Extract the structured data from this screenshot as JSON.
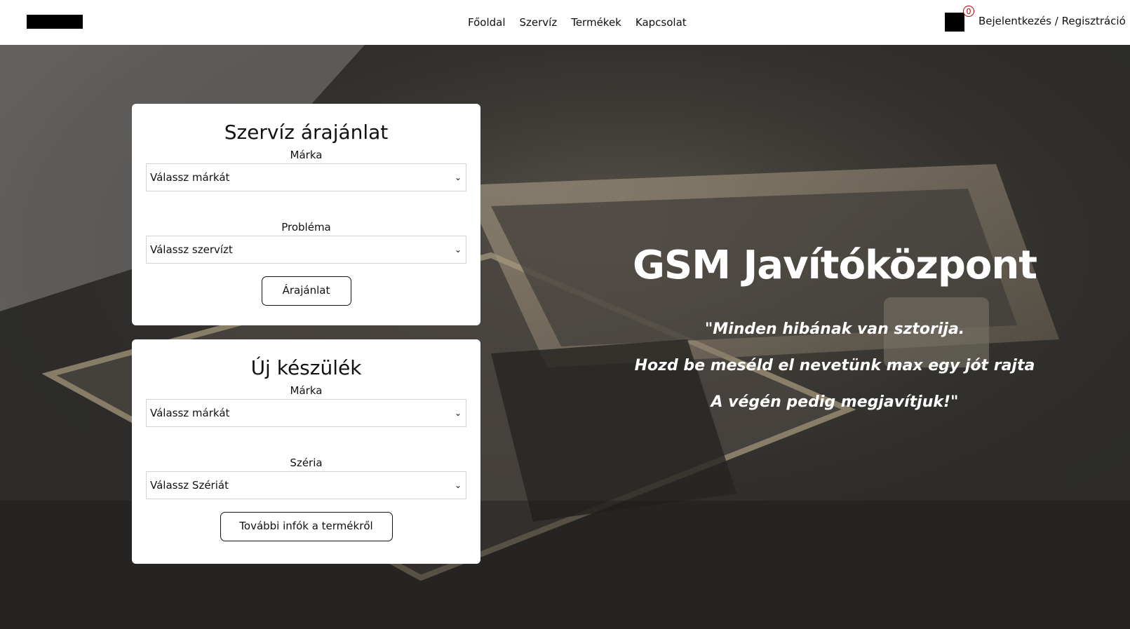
{
  "nav": {
    "links": [
      "Főoldal",
      "Szervíz",
      "Termékek",
      "Kapcsolat"
    ],
    "cart_count": "0",
    "login_label": "Bejelentkezés / Regisztráció"
  },
  "service_quote": {
    "title": "Szervíz árajánlat",
    "brand_label": "Márka",
    "brand_select": "Válassz márkát",
    "problem_label": "Probléma",
    "problem_select": "Válassz szervízt",
    "button": "Árajánlat"
  },
  "new_device": {
    "title": "Új készülék",
    "brand_label": "Márka",
    "brand_select": "Válassz márkát",
    "series_label": "Széria",
    "series_select": "Válassz Szériát",
    "button": "További infók a termékről"
  },
  "hero": {
    "title": "GSM Javítóközpont",
    "quote_lines": [
      "\"Minden hibának van sztorija.",
      "Hozd be meséld el nevetünk max egy jót rajta",
      "A végén pedig megjavítjuk!\""
    ]
  },
  "colors": {
    "navbar_bg": "#ffffff",
    "hero_text": "#ffffff",
    "card_bg": "#ffffff",
    "badge_border": "#b00000"
  },
  "icons": {
    "logo": "logo-placeholder",
    "cart": "cart-icon",
    "select_arrow": "chevron-down-icon"
  }
}
